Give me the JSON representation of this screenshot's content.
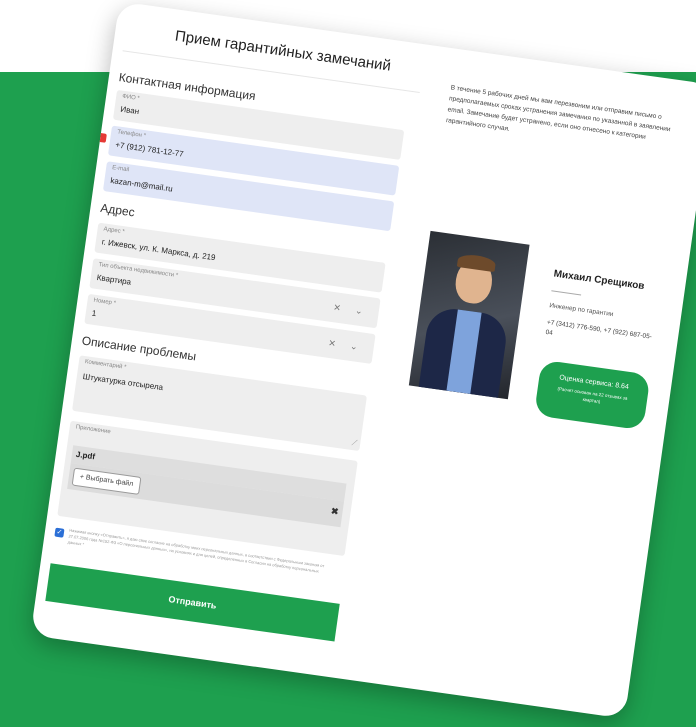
{
  "form": {
    "title": "Прием гарантийных замечаний",
    "sections": {
      "contact": "Контактная информация",
      "address": "Адрес",
      "problem": "Описание проблемы"
    },
    "fields": {
      "name": {
        "label": "ФИО *",
        "value": "Иван"
      },
      "phone": {
        "label": "Телефон *",
        "value": "+7 (912) 781-12-77"
      },
      "email": {
        "label": "E-mail",
        "value": "kazan-m@mail.ru"
      },
      "address": {
        "label": "Адрес *",
        "value": "г. Ижевск, ул. К. Маркса, д. 219"
      },
      "object_type": {
        "label": "Тип объекта недвижимости *",
        "value": "Квартира"
      },
      "number": {
        "label": "Номер *",
        "value": "1"
      },
      "comment": {
        "label": "Комментарий *",
        "value": "Штукатурка отсырела"
      },
      "attachments": {
        "label": "Приложение",
        "file_name": "Ј.pdf",
        "pick_label": "+ Выбрать файл",
        "remove_label": "✖"
      }
    },
    "select_controls": "✕  ⌄",
    "consent": {
      "checked": true,
      "text": "Нажимая кнопку «Отправить», я даю свое согласие на обработку моих персональных данных, в соответствии с Федеральным законом от 27.07.2006 года №152-ФЗ «О персональных данных», на условиях и для целей, определенных в Согласии на обработку персональных данных *"
    },
    "submit_label": "Отправить"
  },
  "info_text": "В течение 5 рабочих дней мы вам перезвоним или отправим письмо о предполагаемых сроках устранения замечания по указанной в заявлении email. Замечание будет устранено, если оно отнесено к категории гарантийного случая.",
  "engineer": {
    "name": "Михаил Срещиков",
    "role": "Инженер по гарантии",
    "phones": "+7 (3412) 776-590, +7 (922) 687-05-04",
    "rating_label": "Оценка сервиса: 8.64",
    "rating_note": "(Расчет основан на 22 отзывах за квартал)"
  },
  "colors": {
    "accent": "#1ea04f",
    "field": "#eeeeee",
    "field_highlight": "#dfe5f7",
    "required_flag": "#e53935"
  }
}
